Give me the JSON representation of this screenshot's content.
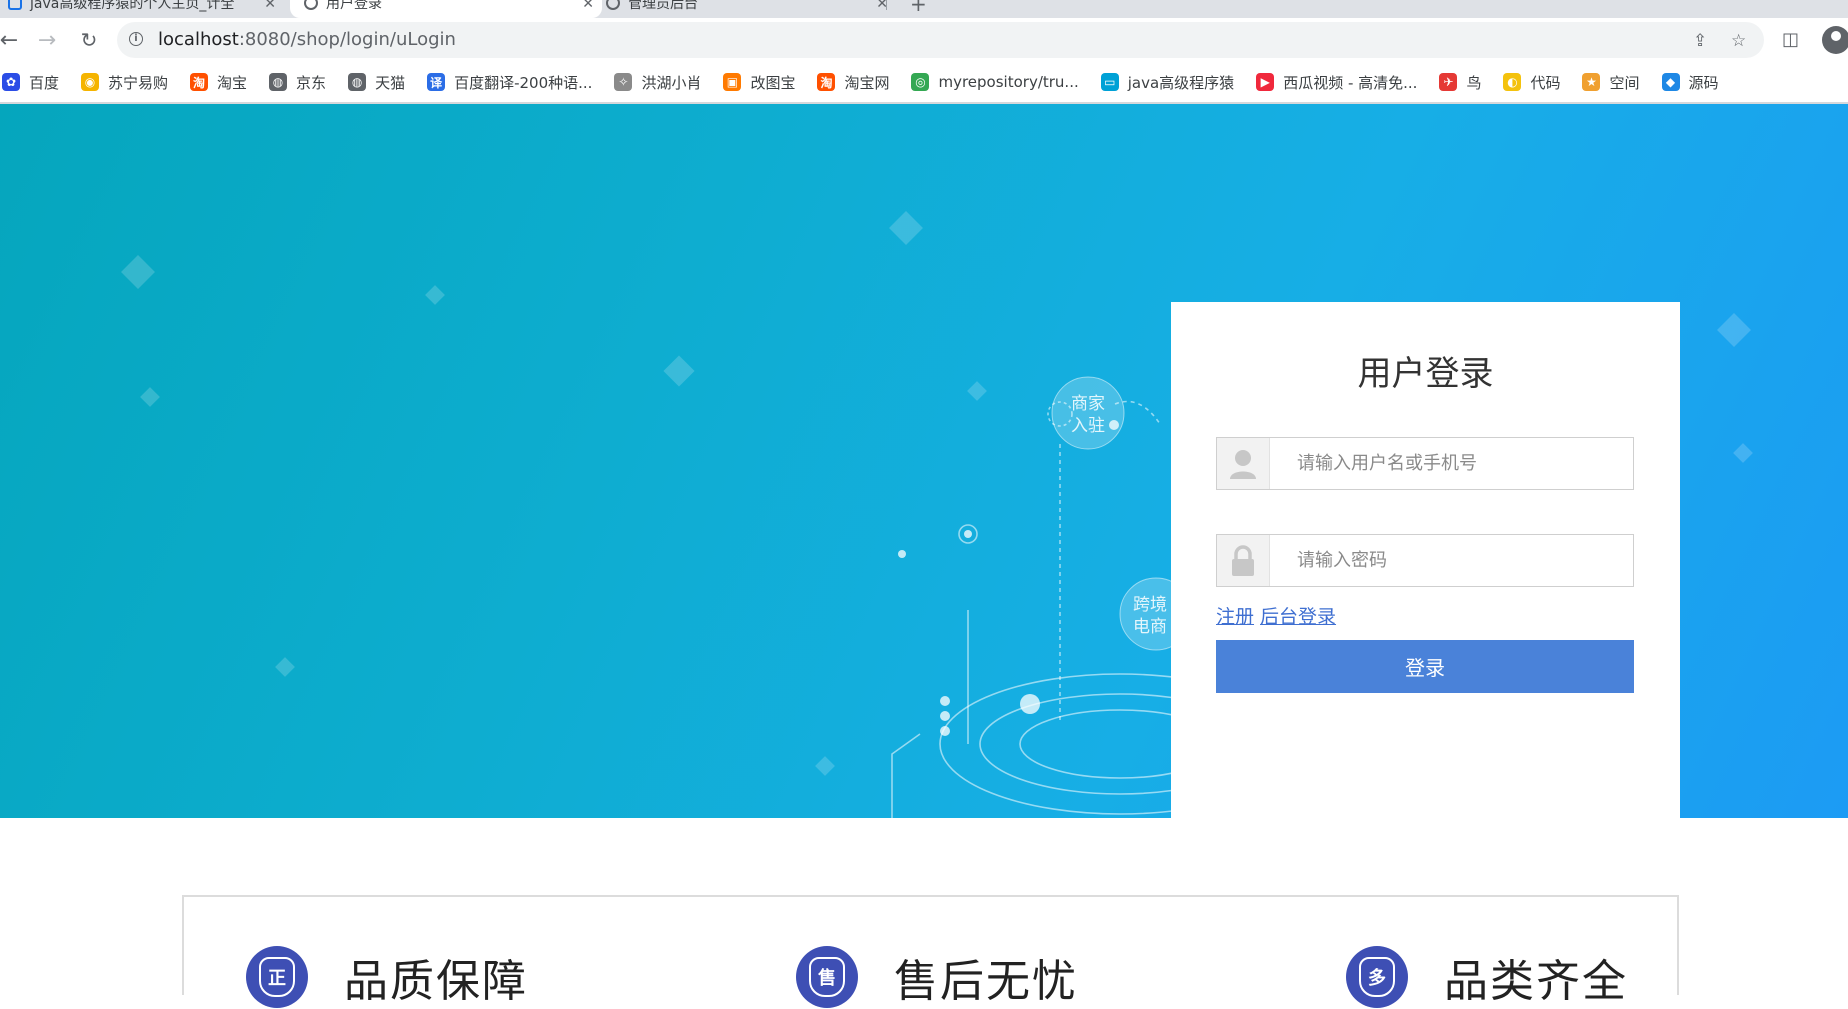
{
  "browser": {
    "tabs": [
      {
        "title": "java高级程序猿的个人主页_计全",
        "active": false
      },
      {
        "title": "用户登录",
        "active": true
      },
      {
        "title": "管理员后台",
        "active": false
      }
    ],
    "url_host": "localhost",
    "url_rest": ":8080/shop/login/uLogin",
    "bookmarks": [
      {
        "label": "百度",
        "icon": "baidu-paw-icon",
        "color": "#2b4de6"
      },
      {
        "label": "苏宁易购",
        "icon": "suning-lion-icon",
        "color": "#f5b400"
      },
      {
        "label": "淘宝",
        "icon": "taobao-icon",
        "color": "#ff5000"
      },
      {
        "label": "京东",
        "icon": "globe-icon",
        "color": "#5f6368"
      },
      {
        "label": "天猫",
        "icon": "globe-icon",
        "color": "#5f6368"
      },
      {
        "label": "百度翻译-200种语...",
        "icon": "translate-icon",
        "color": "#2b6de6"
      },
      {
        "label": "洪湖小肖",
        "icon": "bird-icon",
        "color": "#8a8a8a"
      },
      {
        "label": "改图宝",
        "icon": "gaitubao-icon",
        "color": "#ff7a00"
      },
      {
        "label": "淘宝网",
        "icon": "taobao-tao-icon",
        "color": "#ff5000"
      },
      {
        "label": "myrepository/tru...",
        "icon": "chrome-icon",
        "color": "#34a853"
      },
      {
        "label": "java高级程序猿",
        "icon": "bilibili-tv-icon",
        "color": "#00a1d6"
      },
      {
        "label": "西瓜视频 - 高清免...",
        "icon": "xigua-icon",
        "color": "#f0283c"
      },
      {
        "label": "鸟",
        "icon": "red-bird-icon",
        "color": "#e53935"
      },
      {
        "label": "代码",
        "icon": "code-leaf-icon",
        "color": "#f4c20d"
      },
      {
        "label": "空间",
        "icon": "qzone-icon",
        "color": "#f0a030"
      },
      {
        "label": "源码",
        "icon": "source-fish-icon",
        "color": "#1e88e5"
      }
    ]
  },
  "hero": {
    "deco_text_1": "商家\n入驻",
    "deco_text_2": "跨境\n电商"
  },
  "login": {
    "title": "用户登录",
    "username_placeholder": "请输入用户名或手机号",
    "password_placeholder": "请输入密码",
    "register_link": "注册",
    "admin_link": "后台登录",
    "submit_label": "登录"
  },
  "features": [
    {
      "icon_char": "正",
      "title": "品质保障"
    },
    {
      "icon_char": "售",
      "title": "售后无忧"
    },
    {
      "icon_char": "多",
      "title": "品类齐全"
    }
  ],
  "colors": {
    "login_button": "#4a82d9",
    "link": "#3f6fd1",
    "feature_icon": "#3e4fb4"
  }
}
